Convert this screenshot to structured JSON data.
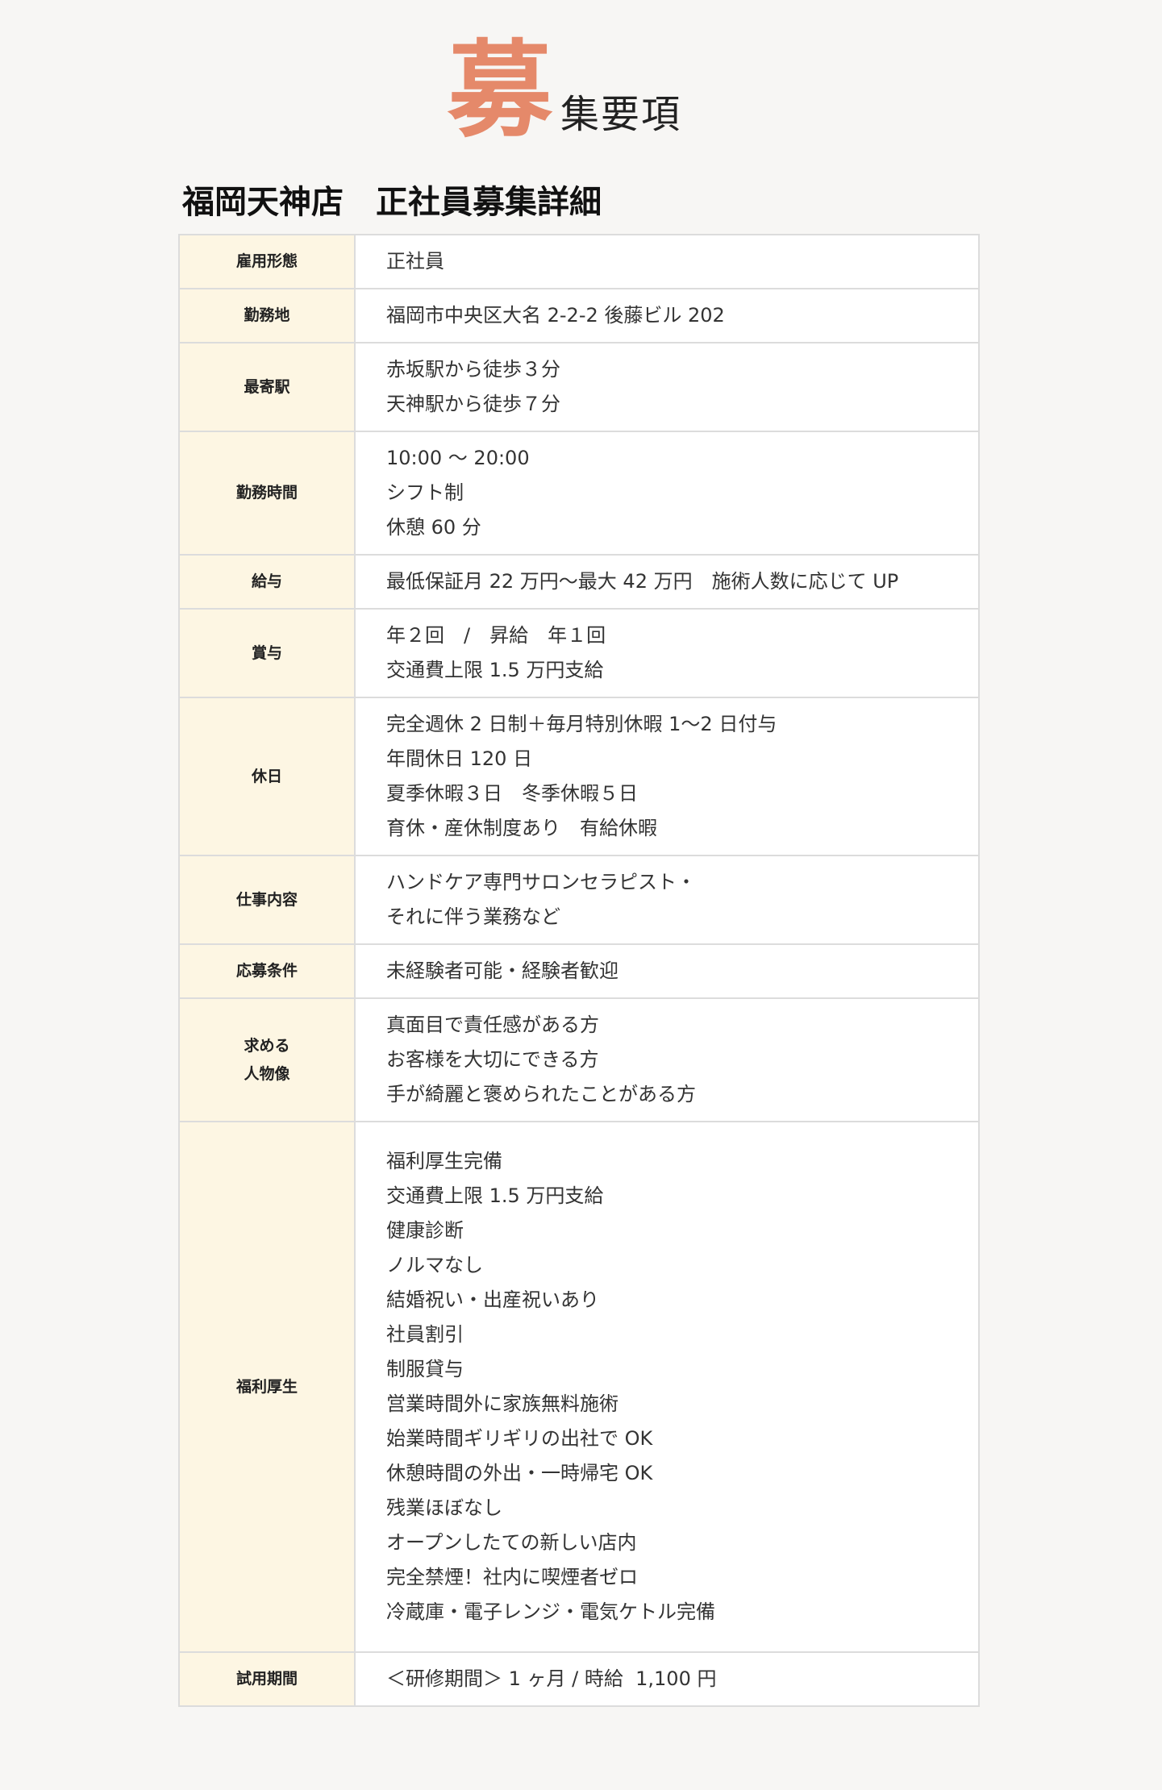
{
  "heading": {
    "big": "募",
    "rest": "集要項"
  },
  "subtitle": "福岡天神店　正社員募集詳細",
  "rows": [
    {
      "label": [
        "雇用形態"
      ],
      "lines": [
        "正社員"
      ]
    },
    {
      "label": [
        "勤務地"
      ],
      "lines": [
        "福岡市中央区大名 2-2-2 後藤ビル 202"
      ]
    },
    {
      "label": [
        "最寄駅"
      ],
      "lines": [
        "赤坂駅から徒歩３分",
        "天神駅から徒歩７分"
      ]
    },
    {
      "label": [
        "勤務時間"
      ],
      "lines": [
        "10:00 ～ 20:00",
        "シフト制",
        "休憩 60 分"
      ]
    },
    {
      "label": [
        "給与"
      ],
      "lines": [
        "最低保証月 22 万円〜最大 42 万円　施術人数に応じて UP"
      ]
    },
    {
      "label": [
        "賞与"
      ],
      "lines": [
        "年２回　/　昇給　年１回",
        "交通費上限 1.5 万円支給"
      ]
    },
    {
      "label": [
        "休日"
      ],
      "lines": [
        "完全週休 2 日制＋毎月特別休暇 1〜2 日付与",
        "年間休日 120 日",
        "夏季休暇３日　冬季休暇５日",
        "育休・産休制度あり　有給休暇"
      ]
    },
    {
      "label": [
        "仕事内容"
      ],
      "lines": [
        "ハンドケア専門サロンセラピスト・",
        "それに伴う業務など"
      ]
    },
    {
      "label": [
        "応募条件"
      ],
      "lines": [
        "未経験者可能・経験者歓迎"
      ]
    },
    {
      "label": [
        "求める",
        "人物像"
      ],
      "lines": [
        "真面目で責任感がある方",
        "お客様を大切にできる方",
        "手が綺麗と褒められたことがある方"
      ]
    },
    {
      "label": [
        "福利厚生"
      ],
      "lines": [
        "福利厚生完備",
        "交通費上限 1.5 万円支給",
        "健康診断",
        "ノルマなし",
        "結婚祝い・出産祝いあり",
        "社員割引",
        "制服貸与",
        "営業時間外に家族無料施術",
        "始業時間ギリギリの出社で OK",
        "休憩時間の外出・一時帰宅 OK",
        "残業ほぼなし",
        "オープンしたての新しい店内",
        "完全禁煙！社内に喫煙者ゼロ",
        "冷蔵庫・電子レンジ・電気ケトル完備"
      ]
    },
    {
      "label": [
        "試用期間"
      ],
      "lines": [
        "＜研修期間＞ 1 ヶ月 / 時給  1,100 円"
      ]
    }
  ]
}
